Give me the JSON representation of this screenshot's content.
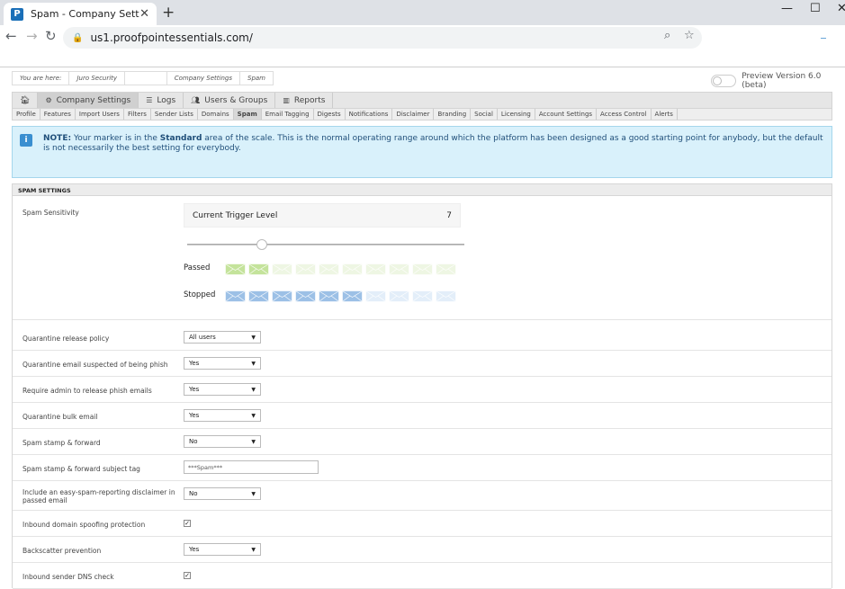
{
  "browser": {
    "tab_title": "Spam - Company Settings",
    "tab_favicon": "P",
    "url": "us1.proofpointessentials.com/"
  },
  "breadcrumb": {
    "prefix": "You are here:",
    "items": [
      "Juro Security",
      "",
      "Company Settings",
      "Spam"
    ]
  },
  "preview": {
    "label": "Preview Version 6.0 (beta)"
  },
  "mainnav": [
    {
      "icon": "home-icon",
      "label": ""
    },
    {
      "icon": "gear-icon",
      "label": "Company Settings"
    },
    {
      "icon": "list-icon",
      "label": "Logs"
    },
    {
      "icon": "users-icon",
      "label": "Users & Groups"
    },
    {
      "icon": "chart-icon",
      "label": "Reports"
    }
  ],
  "subnav": [
    "Profile",
    "Features",
    "Import Users",
    "Filters",
    "Sender Lists",
    "Domains",
    "Spam",
    "Email Tagging",
    "Digests",
    "Notifications",
    "Disclaimer",
    "Branding",
    "Social",
    "Licensing",
    "Account Settings",
    "Access Control",
    "Alerts"
  ],
  "note": {
    "prefix": "NOTE:",
    "text_a": " Your marker is in the ",
    "emphasis": "Standard",
    "text_b": " area of the scale. This is the normal operating range around which the platform has been designed as a good starting point for anybody, but the default is not necessarily the best setting for everybody."
  },
  "settings": {
    "header": "SPAM SETTINGS",
    "sensitivity_label": "Spam Sensitivity",
    "trigger_label": "Current Trigger Level",
    "trigger_value": "7",
    "slider_fraction": 0.27,
    "passed_label": "Passed",
    "passed_active": 2,
    "stopped_label": "Stopped",
    "stopped_active": 6,
    "total_boxes": 10,
    "colors": {
      "passed_on": "#c4e39b",
      "passed_off": "#eef6e3",
      "stopped_on": "#9cc0e6",
      "stopped_off": "#e3eef9"
    },
    "rows": [
      {
        "label": "Quarantine release policy",
        "type": "select",
        "value": "All users"
      },
      {
        "label": "Quarantine email suspected of being phish",
        "type": "select",
        "value": "Yes"
      },
      {
        "label": "Require admin to release phish emails",
        "type": "select",
        "value": "Yes"
      },
      {
        "label": "Quarantine bulk email",
        "type": "select",
        "value": "Yes"
      },
      {
        "label": "Spam stamp & forward",
        "type": "select",
        "value": "No"
      },
      {
        "label": "Spam stamp & forward subject tag",
        "type": "text",
        "value": "***Spam***"
      },
      {
        "label": "Include an easy-spam-reporting disclaimer in passed email",
        "type": "select",
        "value": "No"
      },
      {
        "label": "Inbound domain spoofing protection",
        "type": "checkbox",
        "checked": true
      },
      {
        "label": "Backscatter prevention",
        "type": "select",
        "value": "Yes"
      },
      {
        "label": "Inbound sender DNS check",
        "type": "checkbox",
        "checked": true
      }
    ]
  }
}
